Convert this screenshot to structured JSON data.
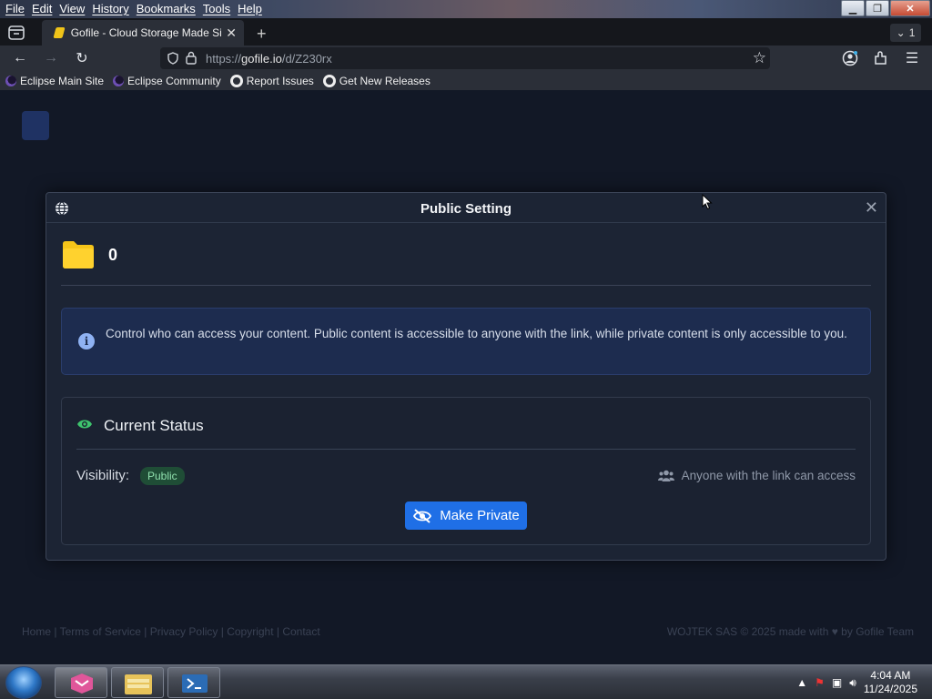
{
  "browser": {
    "menu": [
      "File",
      "Edit",
      "View",
      "History",
      "Bookmarks",
      "Tools",
      "Help"
    ],
    "tab": {
      "title": "Gofile - Cloud Storage Made Sir",
      "count": "1"
    },
    "url": {
      "prefix": "https://",
      "host": "gofile.io",
      "path": "/d/Z230rx"
    },
    "bookmarks": [
      "Eclipse Main Site",
      "Eclipse Community",
      "Report Issues",
      "Get New Releases"
    ]
  },
  "modal": {
    "title": "Public Setting",
    "folder_name": "0",
    "info_text": "Control who can access your content. Public content is accessible to anyone with the link, while private content is only accessible to you.",
    "status_title": "Current Status",
    "visibility_label": "Visibility:",
    "visibility_value": "Public",
    "access_text": "Anyone with the link can access",
    "make_private_label": "Make Private"
  },
  "footer": {
    "links": "Home  |  Terms of Service  |  Privacy Policy  |  Copyright  |  Contact",
    "credit": "WOJTEK SAS © 2025 made with ♥ by Gofile Team"
  },
  "taskbar": {
    "time": "4:04 AM",
    "date": "11/24/2025"
  },
  "colors": {
    "accent": "#1f6fe6",
    "badge_green": "#1f4d36",
    "folder_yellow": "#f6c519"
  }
}
